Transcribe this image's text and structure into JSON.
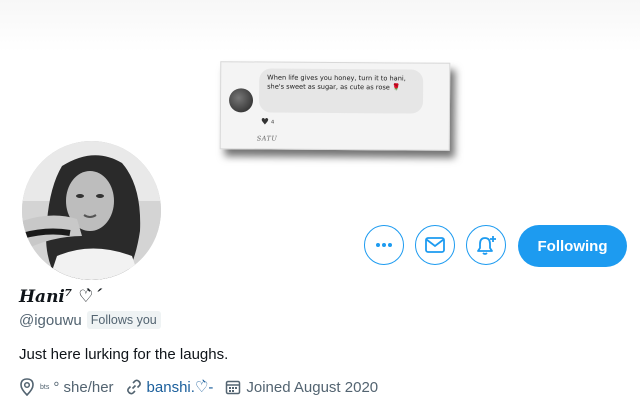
{
  "chat_card": {
    "message": "When life gives you honey, turn it to hani, she's sweet as sugar, as cute as rose 🌹",
    "reaction_count": "4",
    "signature": "SATU"
  },
  "profile": {
    "display_name": "Hani⁷ ♡̀´",
    "handle": "@igouwu",
    "follows_you": "Follows you",
    "bio": "Just here lurking for the laughs.",
    "location_small": "bts",
    "location": "° she/her",
    "website": "banshi.♡̀-",
    "joined": "Joined August 2020"
  },
  "actions": {
    "more_icon": "more-dots-icon",
    "message_icon": "envelope-icon",
    "notify_icon": "bell-plus-icon",
    "follow_label": "Following"
  },
  "colors": {
    "accent": "#1d9bf0",
    "secondary_text": "#536471",
    "link": "#1b5f9c"
  }
}
